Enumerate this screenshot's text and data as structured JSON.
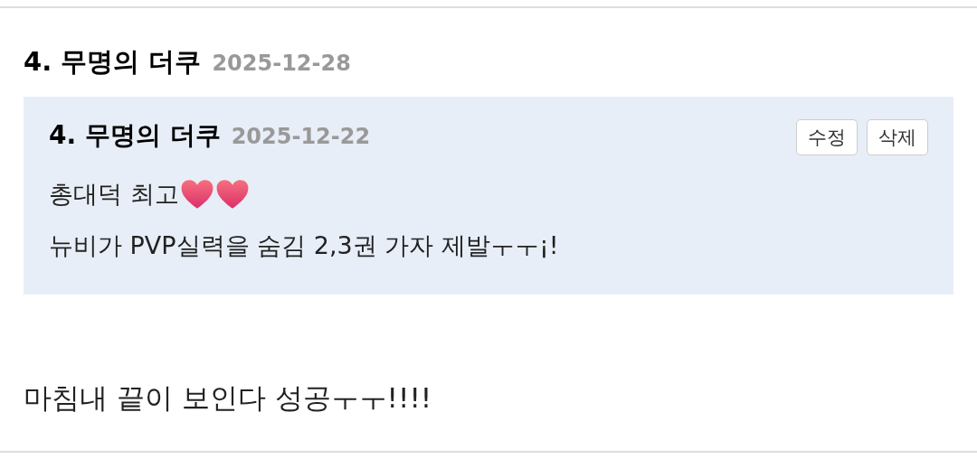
{
  "comment": {
    "number": "4.",
    "author": "무명의 더쿠",
    "date": "2025-12-28",
    "reply": {
      "number": "4.",
      "author": "무명의 더쿠",
      "date": "2025-12-22",
      "buttons": [
        "수정",
        "삭제"
      ],
      "lines": [
        "총대덕 최고",
        "뉴비가 PVP실력을 숨김 2,3권 가자 제발ㅜㅜ¡!"
      ]
    },
    "body": "마침내 끝이 보인다 성공ㅜㅜ!!!!"
  }
}
